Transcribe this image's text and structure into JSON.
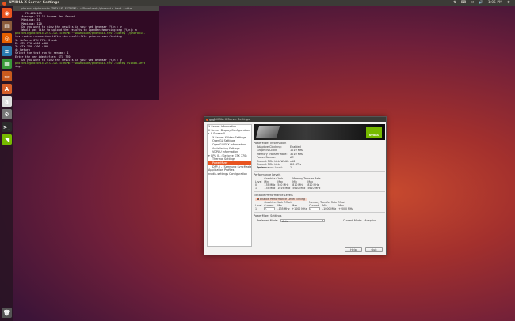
{
  "topbar": {
    "title": "NVIDIA X Server Settings",
    "tray": [
      "⇅",
      "⌨",
      "✉",
      "🔊",
      "1:05 PM",
      "⚙"
    ]
  },
  "launcher": {
    "items": [
      {
        "icon": "ubuntu-dash-icon",
        "glyph": "◉",
        "color": "#e95420"
      },
      {
        "icon": "files-icon",
        "glyph": "▤",
        "color": "#8a5a3b"
      },
      {
        "icon": "firefox-icon",
        "glyph": "◎",
        "color": "#e66000"
      },
      {
        "icon": "writer-icon",
        "glyph": "≡",
        "color": "#2a7ab0"
      },
      {
        "icon": "calc-icon",
        "glyph": "▦",
        "color": "#3a9a3a"
      },
      {
        "icon": "impress-icon",
        "glyph": "▭",
        "color": "#c85a1e"
      },
      {
        "icon": "software-center-icon",
        "glyph": "A",
        "color": "#d65f2a"
      },
      {
        "icon": "amazon-icon",
        "glyph": "a",
        "color": "#ddd"
      },
      {
        "icon": "settings-icon",
        "glyph": "⚙",
        "color": "#777"
      },
      {
        "icon": "terminal-icon",
        "glyph": ">_",
        "color": "#2b2b2b"
      },
      {
        "icon": "nvidia-icon",
        "glyph": "◥",
        "color": "#76b900"
      }
    ],
    "trash_glyph": "🗑"
  },
  "terminal": {
    "title": "phoronix@phoronix-Z97X-UD-EXTREME: ~/Downloads/phoronix-test-suite",
    "lines": [
      {
        "t": "      71.4336163",
        "c": ""
      },
      {
        "t": "",
        "c": ""
      },
      {
        "t": "    Average: 71.16 Frames Per Second",
        "c": ""
      },
      {
        "t": "    Minimum: 31",
        "c": ""
      },
      {
        "t": "    Maximum: 120",
        "c": ""
      },
      {
        "t": "",
        "c": ""
      },
      {
        "t": "    Do you want to view the results in your web browser (Y/n): y",
        "c": ""
      },
      {
        "t": "    Would you like to upload the results to OpenBenchmarking.org (Y/n): n",
        "c": ""
      },
      {
        "t": "",
        "c": ""
      },
      {
        "t": "phoronix@phoronix-Z97X-UD-EXTREME:~/Downloads/phoronix-test-suite$ ./phoronix-",
        "c": "g"
      },
      {
        "t": "test-suite rename-identifier-in-result-file geforce-overclocking",
        "c": ""
      },
      {
        "t": "",
        "c": ""
      },
      {
        "t": "1: GeForce GTX 770: Stock",
        "c": ""
      },
      {
        "t": "2: GTX 770 +200 +400",
        "c": ""
      },
      {
        "t": "3: GTX 770 +200 +800",
        "c": ""
      },
      {
        "t": "4: Return",
        "c": ""
      },
      {
        "t": "Select the test run to rename: 1",
        "c": ""
      },
      {
        "t": "",
        "c": ""
      },
      {
        "t": "Enter the new identifier: GTX 770",
        "c": ""
      },
      {
        "t": "    Do you want to view the results in your web browser (Y/n): y",
        "c": ""
      },
      {
        "t": "",
        "c": ""
      },
      {
        "t": "phoronix@phoronix-Z97X-UD-EXTREME:~/Downloads/phoronix-test-suite$ nvidia-sett",
        "c": "g"
      },
      {
        "t": "ings",
        "c": ""
      }
    ]
  },
  "nvidia": {
    "title": "NVIDIA X Server Settings",
    "tree": [
      {
        "label": "X Server Information",
        "indent": 0,
        "selected": false
      },
      {
        "label": "X Server Display Configuration",
        "indent": 0,
        "selected": false
      },
      {
        "label": "▸ X Screen 0",
        "indent": 0,
        "selected": false
      },
      {
        "label": "X Server XVideo Settings",
        "indent": 1,
        "selected": false
      },
      {
        "label": "OpenGL Settings",
        "indent": 1,
        "selected": false
      },
      {
        "label": "OpenGL/GLX Information",
        "indent": 1,
        "selected": false
      },
      {
        "label": "Antialiasing Settings",
        "indent": 1,
        "selected": false
      },
      {
        "label": "VDPAU Information",
        "indent": 1,
        "selected": false
      },
      {
        "label": "▾ GPU 0 - (GeForce GTX 770)",
        "indent": 0,
        "selected": false
      },
      {
        "label": "Thermal Settings",
        "indent": 1,
        "selected": false
      },
      {
        "label": "PowerMizer",
        "indent": 1,
        "selected": true
      },
      {
        "label": "DFP-0 - (Samsung SyncMaster)",
        "indent": 1,
        "selected": false
      },
      {
        "label": "Application Profiles",
        "indent": 0,
        "selected": false
      },
      {
        "label": "nvidia-settings Configuration",
        "indent": 0,
        "selected": false
      }
    ],
    "logo_text": "NVIDIA",
    "powermizer": {
      "header": "PowerMizer Information",
      "info": [
        {
          "k": "Adaptive Clocking:",
          "v": "Enabled"
        },
        {
          "k": "Graphics Clock:",
          "v": "1019 MHz"
        },
        {
          "k": "Memory Transfer Rate:",
          "v": "3010 MHz"
        },
        {
          "k": "Power Source:",
          "v": "AC"
        },
        {
          "k": "Current PCIe Link Width:",
          "v": "x16"
        },
        {
          "k": "Current PCIe Link Speed:",
          "v": "8.0 GT/s"
        },
        {
          "k": "Performance Level:",
          "v": "1"
        }
      ],
      "perf_levels_label": "Performance Levels",
      "perf_table": {
        "group_headers": [
          "Graphics Clock",
          "Memory Transfer Rate"
        ],
        "col_headers": [
          "Level",
          "Min",
          "Max",
          "Min",
          "Max"
        ],
        "rows": [
          [
            "0",
            "135 MHz",
            "540 MHz",
            "810 MHz",
            "810 MHz"
          ],
          [
            "1",
            "135 MHz",
            "1019 MHz",
            "5610 MHz",
            "5610 MHz"
          ]
        ]
      },
      "editable_label": "Editable Performance Levels",
      "enable_checkbox_label": "Enable Performance Level Editing",
      "edit_table": {
        "group_headers": [
          "Graphics Clock Offset",
          "Memory Transfer Rate Offset"
        ],
        "col_headers": [
          "Level",
          "Current",
          "Min",
          "Max",
          "Current",
          "Min",
          "Max"
        ],
        "rows": [
          [
            "1",
            "0",
            "-135 MHz",
            "+1000 MHz",
            "0",
            "-1000 MHz",
            "+2000 MHz"
          ]
        ]
      },
      "mode_section": "PowerMizer Settings",
      "preferred_mode_label": "Preferred Mode:",
      "preferred_mode_value": "Auto",
      "current_mode_label": "Current Mode:",
      "current_mode_value": "Adaptive"
    },
    "buttons": {
      "help": "Help",
      "quit": "Quit"
    }
  }
}
